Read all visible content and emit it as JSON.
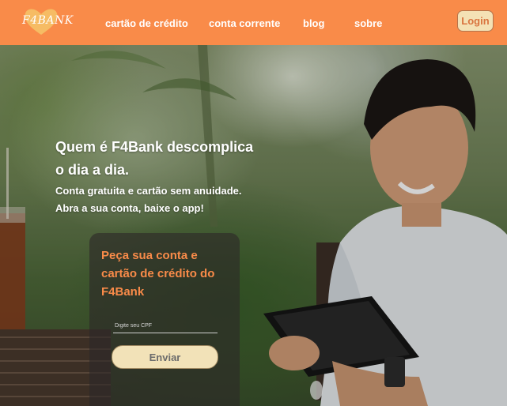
{
  "brand": {
    "logo_text": "F4BANK",
    "accent_color": "#f98b49",
    "button_color": "#f2e2b8"
  },
  "nav": {
    "links": [
      "cartão de crédito",
      "conta corrente",
      "blog",
      "sobre"
    ],
    "login_label": "Login"
  },
  "hero": {
    "title_line1": "Quem é F4Bank descomplica",
    "title_line2": "o dia a dia.",
    "subtitle_line1": "Conta gratuita e cartão sem anuidade.",
    "subtitle_line2": "Abra a sua conta, baixe o app!"
  },
  "signup": {
    "title": "Peça sua conta e cartão de crédito do F4Bank",
    "cpf_placeholder": "Digite seu CPF",
    "cpf_value": "",
    "submit_label": "Enviar"
  }
}
